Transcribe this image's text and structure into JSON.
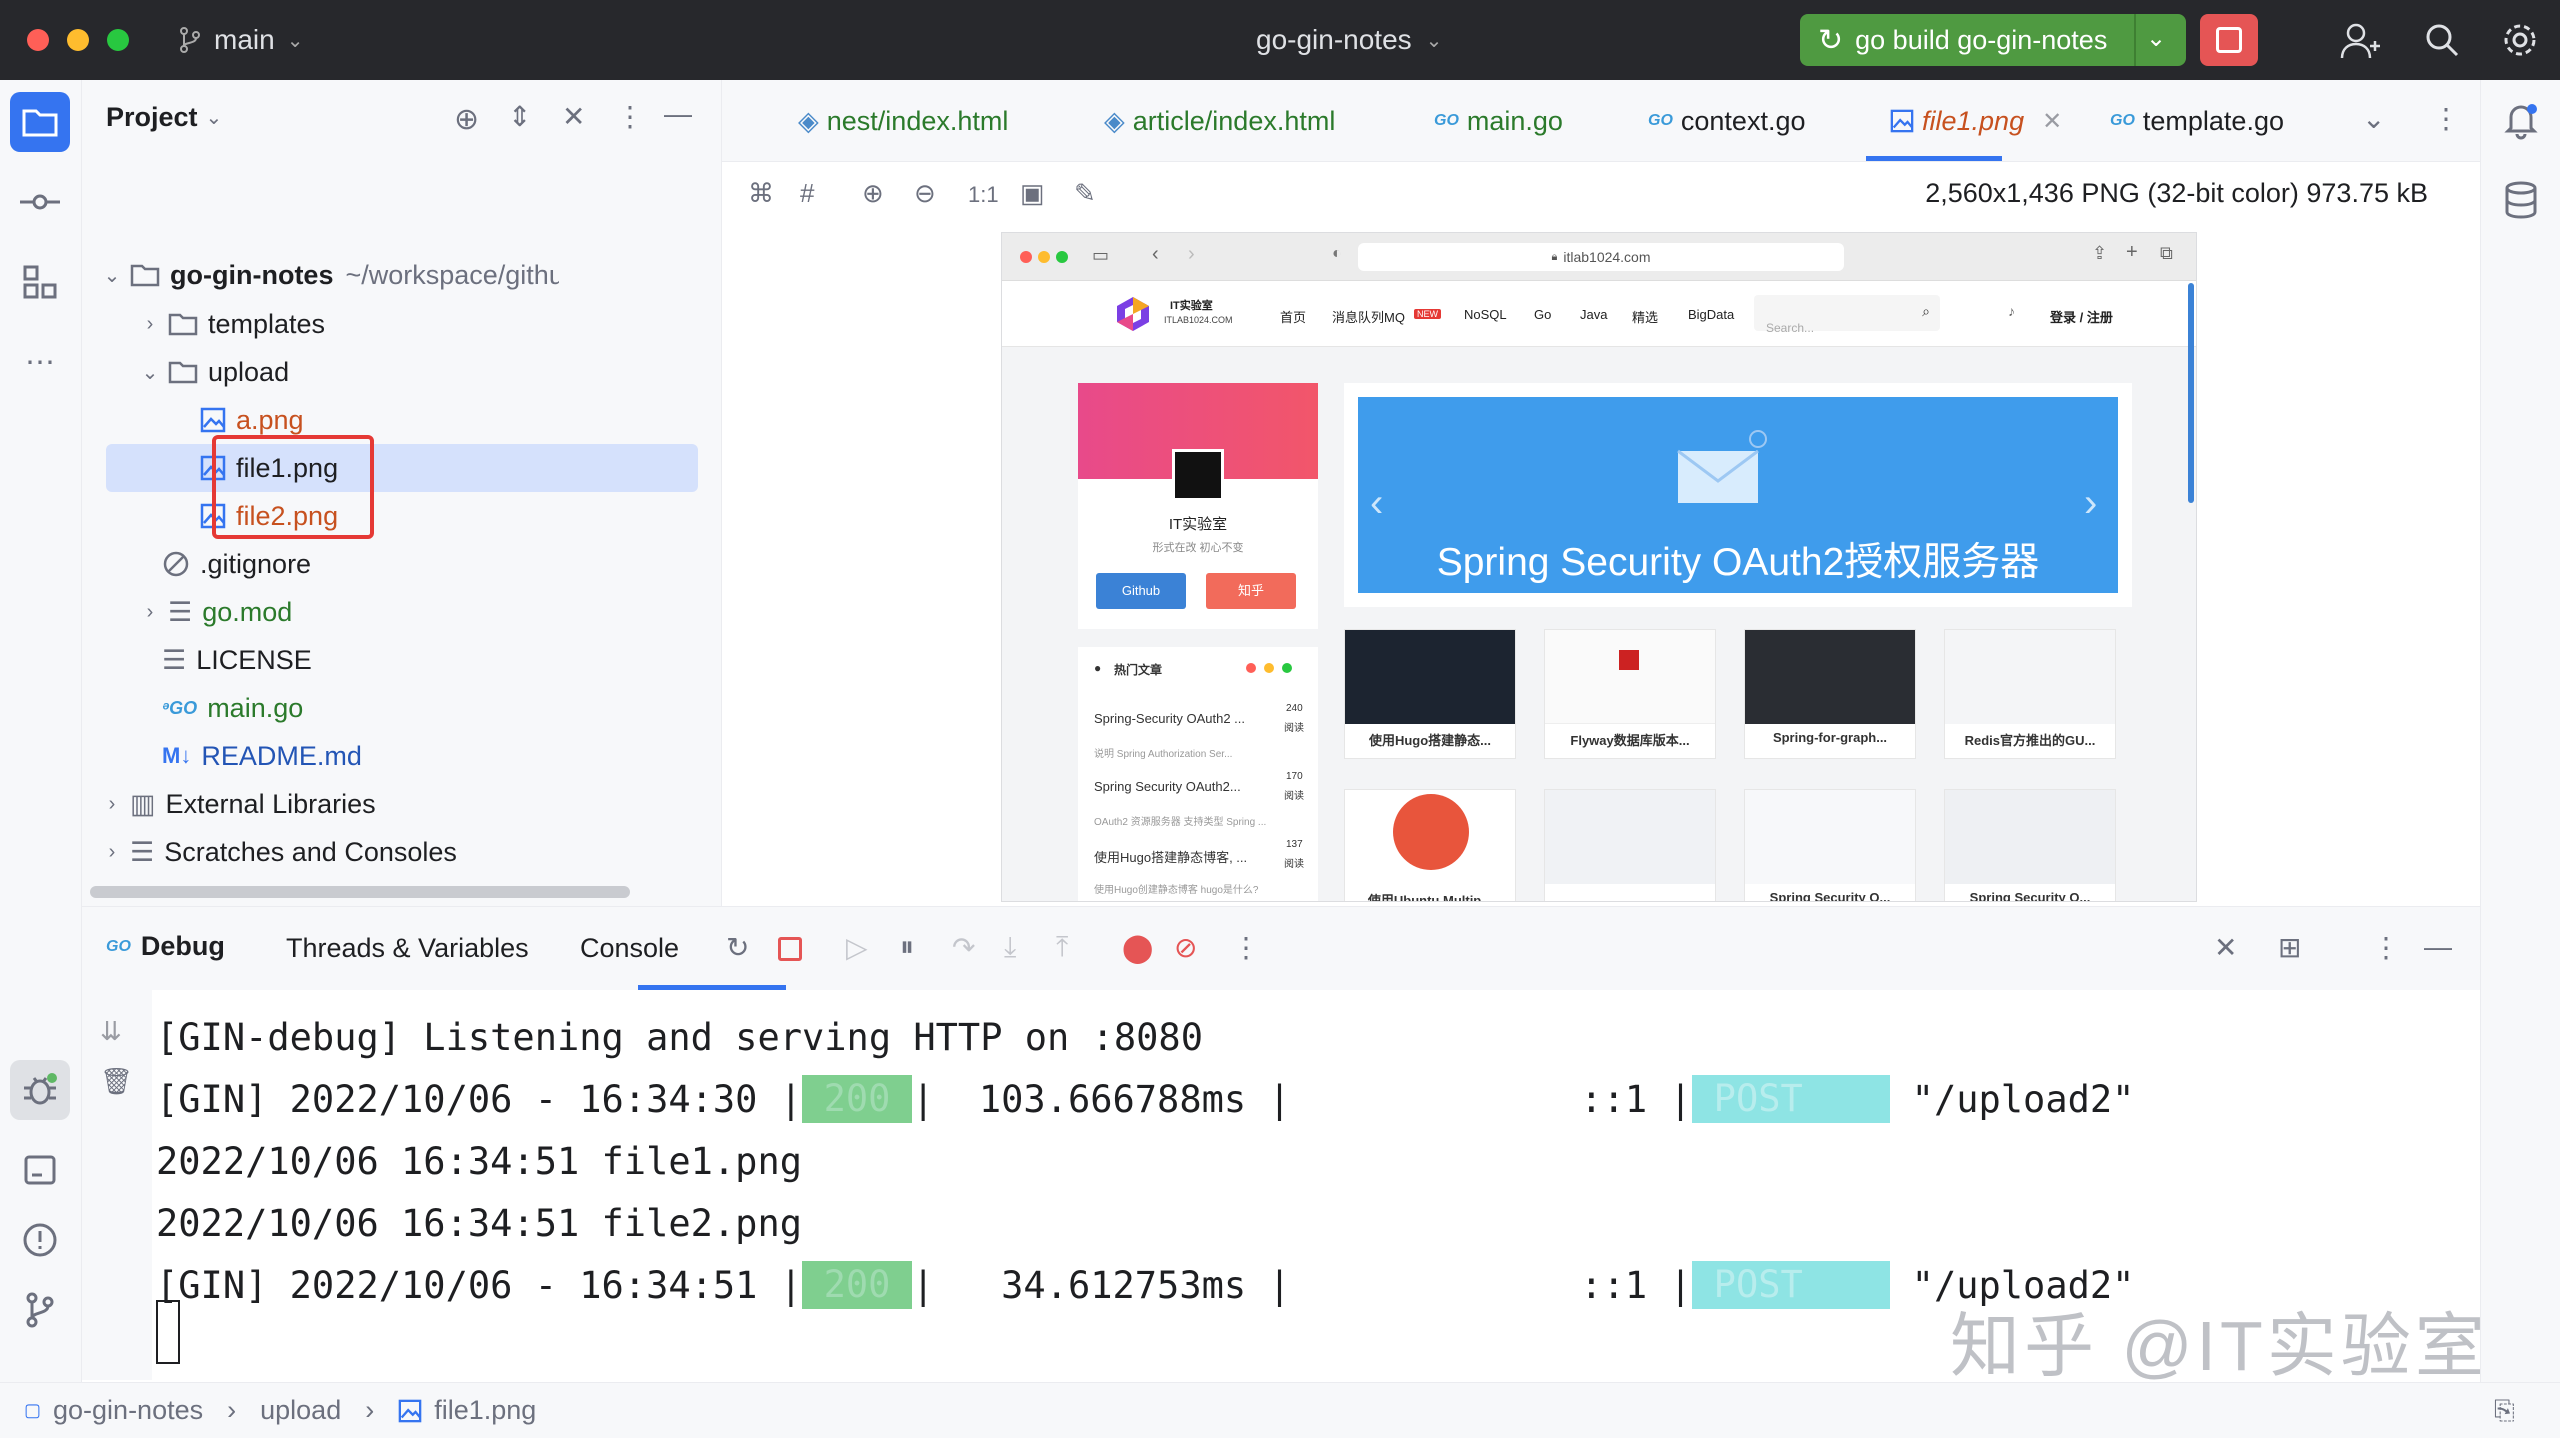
{
  "titlebar": {
    "branch": "main",
    "project": "go-gin-notes",
    "run_config": "go build go-gin-notes",
    "colors": {
      "close": "#ff5f57",
      "min": "#febc2e",
      "max": "#28c840",
      "run": "#4f9a41",
      "stop": "#e55555"
    }
  },
  "project_panel": {
    "title": "Project",
    "root": {
      "name": "go-gin-notes",
      "path": "~/workspace/github/go-gin-notes"
    },
    "items": [
      {
        "label": "templates"
      },
      {
        "label": "upload"
      },
      {
        "label": "a.png"
      },
      {
        "label": "file1.png"
      },
      {
        "label": "file2.png"
      },
      {
        "label": ".gitignore"
      },
      {
        "label": "go.mod"
      },
      {
        "label": "LICENSE"
      },
      {
        "label": "main.go"
      },
      {
        "label": "README.md"
      },
      {
        "label": "External Libraries"
      },
      {
        "label": "Scratches and Consoles"
      }
    ]
  },
  "editor": {
    "tabs": [
      {
        "label": "nest/index.html"
      },
      {
        "label": "article/index.html"
      },
      {
        "label": "main.go"
      },
      {
        "label": "context.go"
      },
      {
        "label": "file1.png"
      },
      {
        "label": "template.go"
      }
    ],
    "active_tab": "file1.png",
    "zoom_label": "1:1",
    "image_info": "2,560x1,436 PNG (32-bit color) 973.75 kB"
  },
  "preview": {
    "url": "itlab1024.com",
    "logo_line1": "IT实验室",
    "logo_line2": "ITLAB1024.COM",
    "nav": [
      "首页",
      "消息队列MQ",
      "NEW",
      "NoSQL",
      "Go",
      "Java",
      "精选",
      "BigData"
    ],
    "search_placeholder": "Search...",
    "login": "登录 / 注册",
    "profile": {
      "name": "IT实验室",
      "motto": "形式在改 初心不变",
      "btn1": "Github",
      "btn2": "知乎"
    },
    "banner": "Spring Security OAuth2授权服务器",
    "hot": {
      "title": "热门文章",
      "items": [
        {
          "title": "Spring-Security OAuth2 ...",
          "count": "240",
          "unit": "阅读",
          "desc": "说明 Spring Authorization Ser..."
        },
        {
          "title": "Spring Security OAuth2...",
          "count": "170",
          "unit": "阅读",
          "desc": "OAuth2 资源服务器 支持类型 Spring ..."
        },
        {
          "title": "使用Hugo搭建静态博客, ...",
          "count": "137",
          "unit": "阅读",
          "desc": "使用Hugo创建静态博客 hugo是什么?"
        }
      ]
    },
    "thumbs": [
      {
        "caption": "使用Hugo搭建静态..."
      },
      {
        "caption": "Flyway数据库版本..."
      },
      {
        "caption": "Spring-for-graph..."
      },
      {
        "caption": "Redis官方推出的GU..."
      },
      {
        "caption": "使用Ubuntu Multip..."
      },
      {
        "caption": ""
      },
      {
        "caption": "Spring Security O..."
      },
      {
        "caption": "Spring Security O..."
      }
    ]
  },
  "debug": {
    "title": "Debug",
    "tabs": [
      "Threads & Variables",
      "Console"
    ],
    "active": "Console",
    "console": {
      "line1": "[GIN-debug] Listening and serving HTTP on :8080",
      "l2_pre": "[GIN] 2022/10/06 - 16:34:30 |",
      "l2_code": "200",
      "l2_mid": "|  103.666788ms |             ::1 |",
      "l2_method": "POST",
      "l2_path": "\"/upload2\"",
      "line3": "2022/10/06 16:34:51 file1.png",
      "line4": "2022/10/06 16:34:51 file2.png",
      "l5_pre": "[GIN] 2022/10/06 - 16:34:51 |",
      "l5_code": "200",
      "l5_mid": "|   34.612753ms |             ::1 |",
      "l5_method": "POST",
      "l5_path": "\"/upload2\""
    }
  },
  "watermark": "知乎 @IT实验室",
  "statusbar": {
    "crumbs": [
      "go-gin-notes",
      "upload",
      "file1.png"
    ]
  }
}
